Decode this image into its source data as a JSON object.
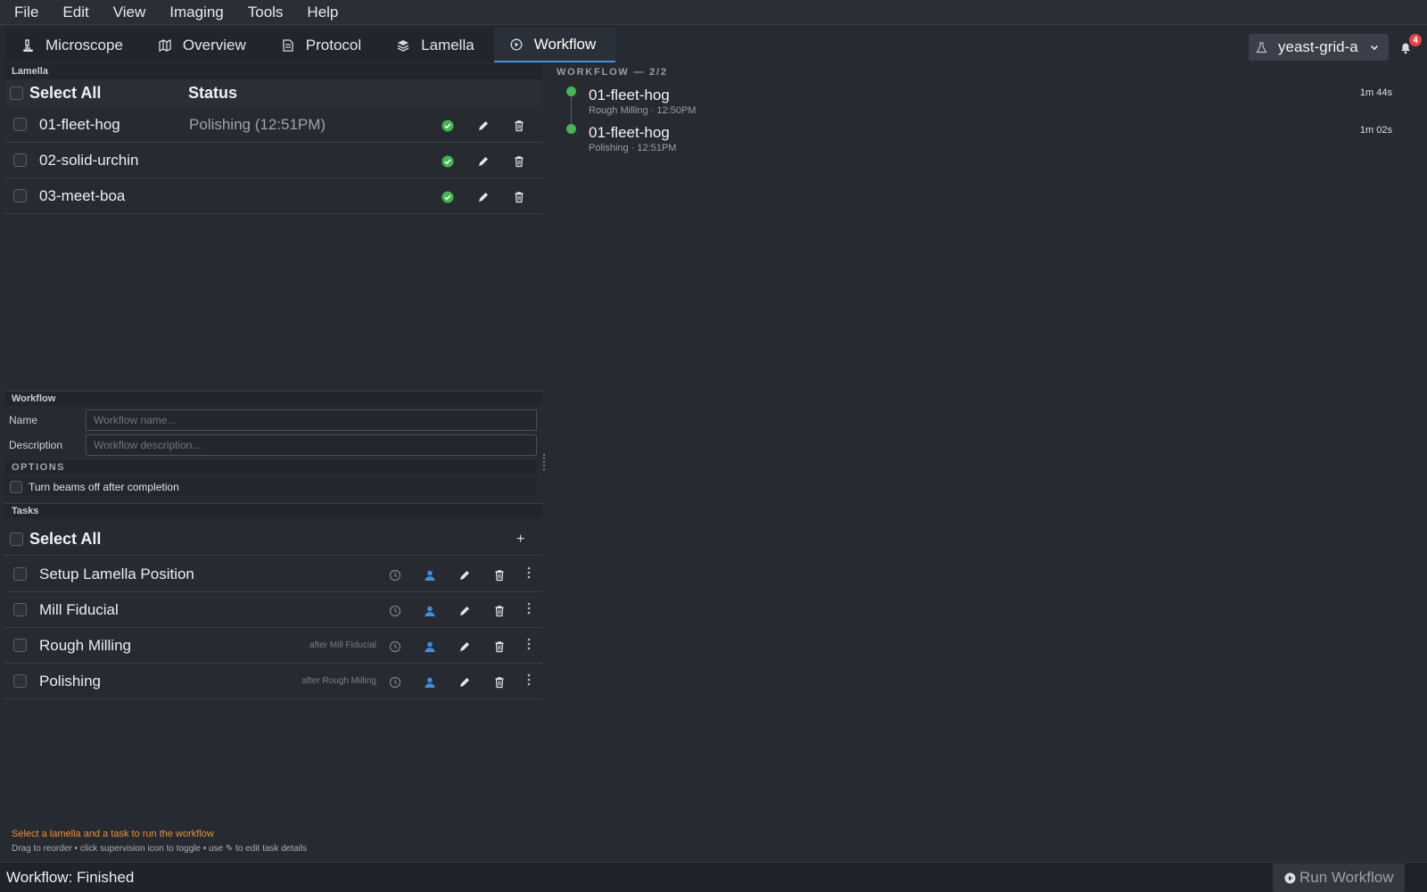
{
  "menu": [
    "File",
    "Edit",
    "View",
    "Imaging",
    "Tools",
    "Help"
  ],
  "tabs": [
    {
      "label": "Microscope",
      "icon": "microscope-icon"
    },
    {
      "label": "Overview",
      "icon": "map-icon"
    },
    {
      "label": "Protocol",
      "icon": "document-icon"
    },
    {
      "label": "Lamella",
      "icon": "layers-icon"
    },
    {
      "label": "Workflow",
      "icon": "play-circle-icon",
      "active": true
    }
  ],
  "experiment": {
    "name": "yeast-grid-a"
  },
  "notifications": {
    "count": "4"
  },
  "lamella_section": {
    "title": "Lamella",
    "select_all": "Select All",
    "status_header": "Status",
    "rows": [
      {
        "name": "01-fleet-hog",
        "status": "Polishing (12:51PM)"
      },
      {
        "name": "02-solid-urchin",
        "status": ""
      },
      {
        "name": "03-meet-boa",
        "status": ""
      }
    ]
  },
  "workflow_section": {
    "title": "Workflow",
    "name_label": "Name",
    "name_placeholder": "Workflow name...",
    "description_label": "Description",
    "description_placeholder": "Workflow description...",
    "options_title": "OPTIONS",
    "beams_off_label": "Turn beams off after completion"
  },
  "tasks_section": {
    "title": "Tasks",
    "select_all": "Select All",
    "add": "+",
    "rows": [
      {
        "name": "Setup Lamella Position",
        "after": ""
      },
      {
        "name": "Mill Fiducial",
        "after": ""
      },
      {
        "name": "Rough Milling",
        "after": "after Mill Fiducial"
      },
      {
        "name": "Polishing",
        "after": "after Rough Milling"
      }
    ]
  },
  "hints": {
    "warning": "Select a lamella and a task to run the workflow",
    "help": "Drag to reorder  •  click supervision icon to toggle  •  use ✎ to edit task details"
  },
  "status_bar": {
    "text": "Workflow: Finished",
    "run_button": "Run Workflow"
  },
  "workflow_progress": {
    "title": "WORKFLOW — 2/2",
    "steps": [
      {
        "name": "01-fleet-hog",
        "detail": "Rough Milling · 12:50PM",
        "duration": "1m 44s"
      },
      {
        "name": "01-fleet-hog",
        "detail": "Polishing · 12:51PM",
        "duration": "1m 02s"
      }
    ]
  },
  "colors": {
    "accent": "#4a90d9",
    "success": "#44b552",
    "warning": "#e8913a",
    "supervise": "#3d8fe0",
    "badge": "#e64545"
  }
}
